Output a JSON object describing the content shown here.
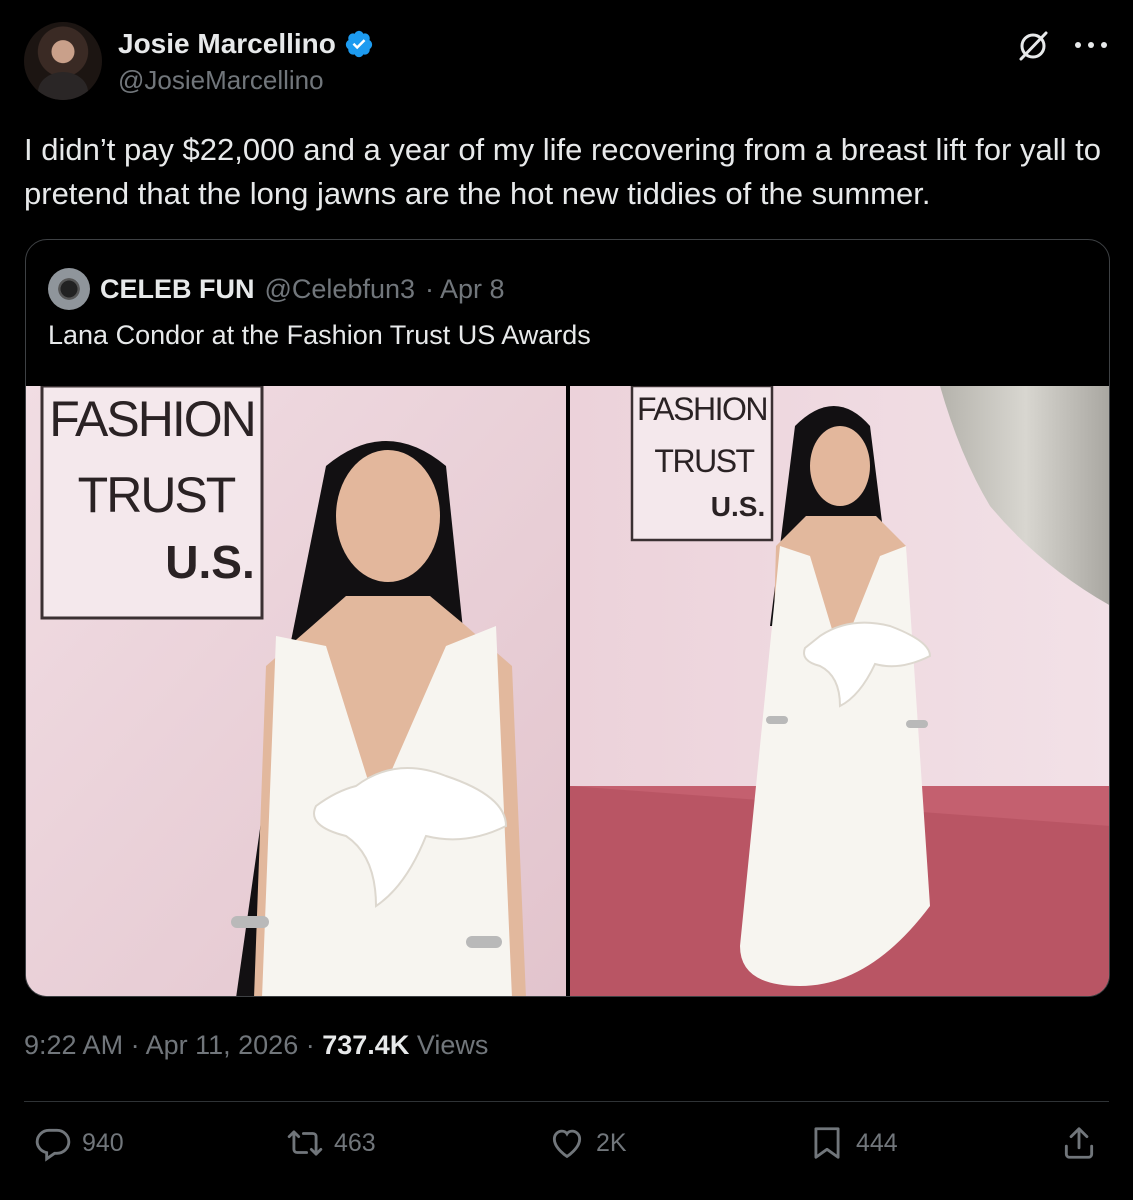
{
  "author": {
    "name": "Josie Marcellino",
    "handle": "@JosieMarcellino",
    "verified": true
  },
  "tweet": {
    "text": "I didn’t pay $22,000 and a year of my life recovering from a breast lift for yall to pretend that the long jawns are the hot new tiddies of the summer."
  },
  "quote": {
    "name": "CELEB FUN",
    "handle": "@Celebfun3",
    "date": "· Apr 8",
    "text": "Lana Condor at the Fashion Trust US Awards",
    "photo_left_sign": [
      "FASHION",
      "TRUST",
      "U.S."
    ],
    "photo_right_sign": [
      "FASHION",
      "TRUST",
      "U.S."
    ]
  },
  "meta": {
    "time": "9:22 AM",
    "date": "Apr 11, 2026",
    "views_count": "737.4K",
    "views_label": "Views",
    "separator": "·"
  },
  "actions": {
    "replies": "940",
    "reposts": "463",
    "likes": "2K",
    "bookmarks": "444"
  },
  "colors": {
    "background": "#000000",
    "text": "#e7e9ea",
    "secondary": "#71767b",
    "verified": "#1d9bf0",
    "border": "#2f3336"
  }
}
